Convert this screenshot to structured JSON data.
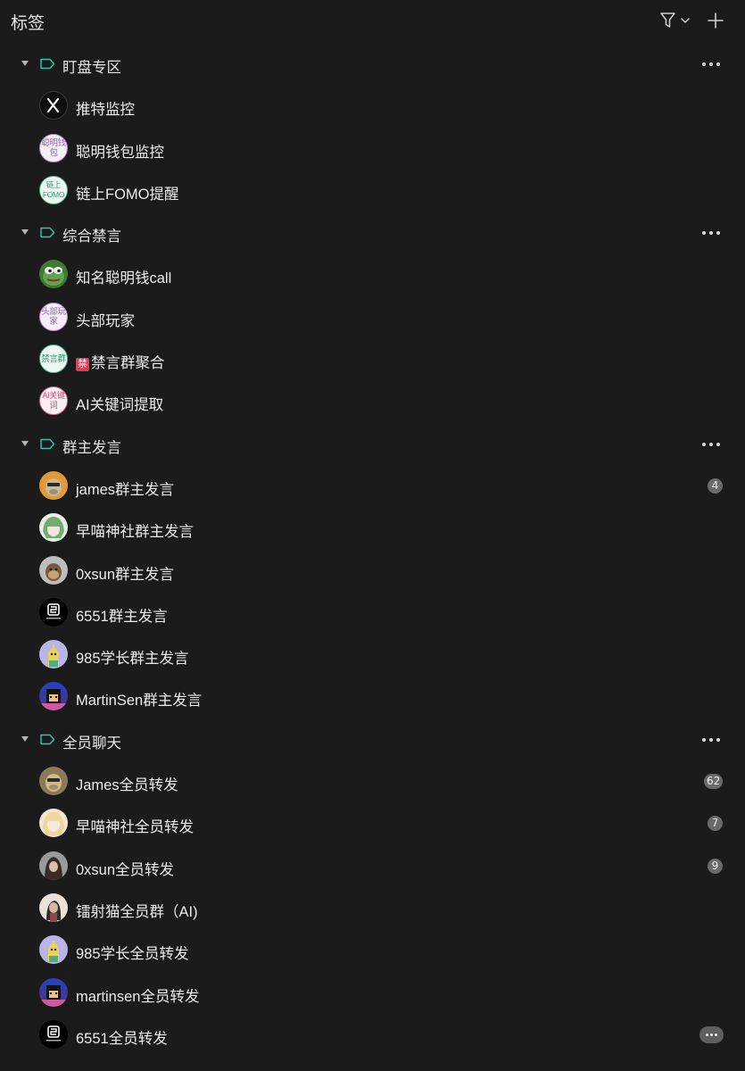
{
  "header": {
    "title": "标签"
  },
  "groups": [
    {
      "label": "盯盘专区",
      "items": [
        {
          "label": "推特监控",
          "avatar": "x-logo"
        },
        {
          "label": "聪明钱包监控",
          "avatar_text": "聪明钱包",
          "avatar": "text-avatar-purple"
        },
        {
          "label": "链上FOMO提醒",
          "avatar_text": "链上FOMO",
          "avatar": "text-avatar-green"
        }
      ]
    },
    {
      "label": "综合禁言",
      "items": [
        {
          "label": "知名聪明钱call",
          "avatar": "pepe-frog-avatar"
        },
        {
          "label": "头部玩家",
          "avatar_text": "头部玩家",
          "avatar": "text-avatar-purple"
        },
        {
          "label": "禁言群聚合",
          "prefix_icon": "禁",
          "avatar_text": "禁言群",
          "avatar": "text-avatar-green"
        },
        {
          "label": "AI关键词提取",
          "avatar_text": "AI关键词",
          "avatar": "text-avatar-pink"
        }
      ]
    },
    {
      "label": "群主发言",
      "items": [
        {
          "label": "james群主发言",
          "badge": "4",
          "avatar": "ape-avatar-orange"
        },
        {
          "label": "早喵神社群主发言",
          "avatar": "anime-avatar-green"
        },
        {
          "label": "0xsun群主发言",
          "avatar": "ape-avatar-grey"
        },
        {
          "label": "6551群主发言",
          "avatar": "6551-logo-avatar"
        },
        {
          "label": "985学长群主发言",
          "avatar": "cartoon-avatar-lilac"
        },
        {
          "label": "MartinSen群主发言",
          "avatar": "pixel-avatar"
        }
      ]
    },
    {
      "label": "全员聊天",
      "items": [
        {
          "label": "James全员转发",
          "badge": "62",
          "avatar": "ape-avatar-orange-2"
        },
        {
          "label": "早喵神社全员转发",
          "badge": "7",
          "avatar": "anime-avatar-blonde"
        },
        {
          "label": "0xsun全员转发",
          "badge": "9",
          "avatar": "hooded-avatar"
        },
        {
          "label": "镭射猫全员群（AI)",
          "avatar": "portrait-avatar"
        },
        {
          "label": "985学长全员转发",
          "avatar": "cartoon-avatar-lilac-2"
        },
        {
          "label": "martinsen全员转发",
          "avatar": "pixel-avatar-2"
        },
        {
          "label": "6551全员转发",
          "badge_more": true,
          "avatar": "6551-logo-avatar-2"
        }
      ]
    }
  ],
  "icons": {
    "header_filter": "filter-funnel-icon",
    "header_add": "plus-icon",
    "group_toggle": "caret-down-icon",
    "group_tag": "tag-outline-icon",
    "group_more": "more-horizontal-icon"
  },
  "colors": {
    "background": "#1b1b1b",
    "tag_icon": "#2fc6a8",
    "badge": "#6a6a6a",
    "text": "#ededed"
  }
}
